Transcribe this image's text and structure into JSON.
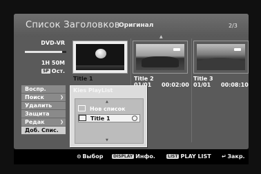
{
  "header": {
    "title": "Список Заголовков",
    "subtitle": "Оригинал",
    "page_indicator": "2/3"
  },
  "disc_info": {
    "disc_type": "DVD-VR",
    "remaining_fraction": 0.9,
    "remaining_time": "1H 50M",
    "mode_badge": "SP",
    "mode_text": "Ост."
  },
  "titles": [
    {
      "name": "Title 1",
      "date": "",
      "duration": "",
      "selected": true
    },
    {
      "name": "Title 2",
      "date": "01/01",
      "duration": "00:02:00",
      "selected": false
    },
    {
      "name": "Title 3",
      "date": "01/01",
      "duration": "00:08:10",
      "selected": false
    }
  ],
  "menu": {
    "items": [
      {
        "label": "Воспр.",
        "has_submenu": false
      },
      {
        "label": "Поиск",
        "has_submenu": true
      },
      {
        "label": "Удалить",
        "has_submenu": false
      },
      {
        "label": "Защита",
        "has_submenu": false
      },
      {
        "label": "Редак",
        "has_submenu": true
      },
      {
        "label": "Доб. Спис.",
        "has_submenu": false
      }
    ],
    "selected_index": 5
  },
  "popup": {
    "title": "Kies PlayList",
    "items": [
      {
        "label": "Нов список"
      },
      {
        "label": "Title 1"
      }
    ],
    "selected_index": 1
  },
  "footer": {
    "select": "Выбор",
    "display_key": "DISPLAY",
    "display_label": "Инфо.",
    "list_key": "LIST",
    "list_label": "PLAY LIST",
    "close_label": "Закр."
  },
  "icons": {
    "select": "ok-circle-icon",
    "close": "return-arrow-icon",
    "playlist": "playlist-icon"
  },
  "colors": {
    "panel": "#5a5a5a",
    "menu_item": "#8a8a8a",
    "highlight": "#ededed"
  }
}
